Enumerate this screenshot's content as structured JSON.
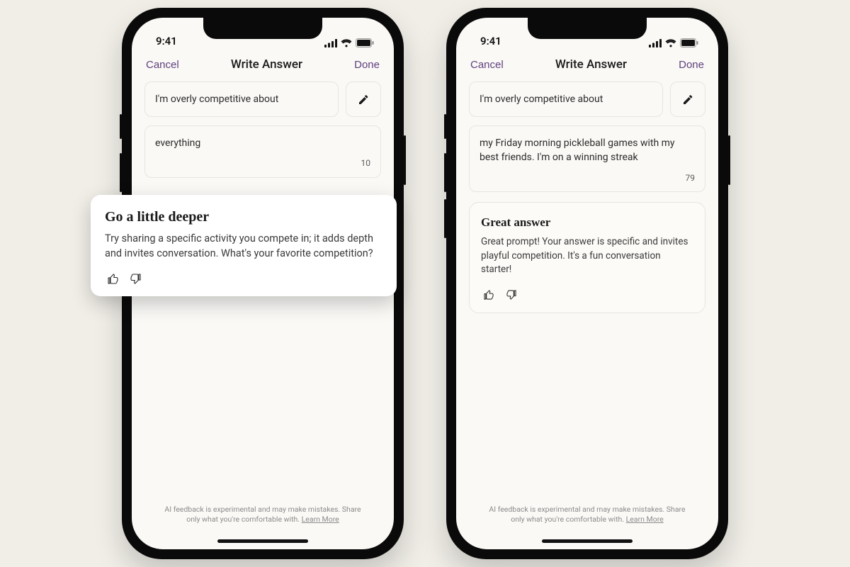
{
  "status": {
    "time": "9:41"
  },
  "nav": {
    "cancel": "Cancel",
    "title": "Write Answer",
    "done": "Done"
  },
  "left": {
    "prompt": "I'm overly competitive about",
    "answer": "everything",
    "char_count": "10",
    "feedback_title": "Go a little deeper",
    "feedback_body": "Try sharing a specific activity you compete in; it adds depth and invites conversation. What's your favorite competition?"
  },
  "right": {
    "prompt": "I'm overly competitive about",
    "answer": "my Friday morning pickleball games with my best friends. I'm on a winning streak",
    "char_count": "79",
    "feedback_title": "Great answer",
    "feedback_body": "Great prompt! Your answer is specific and invites playful competition. It's a fun conversation starter!"
  },
  "disclaimer": {
    "line1": "AI feedback is experimental and may make mistakes. Share",
    "line2_pre": "only what you're comfortable with. ",
    "learn": "Learn More"
  }
}
